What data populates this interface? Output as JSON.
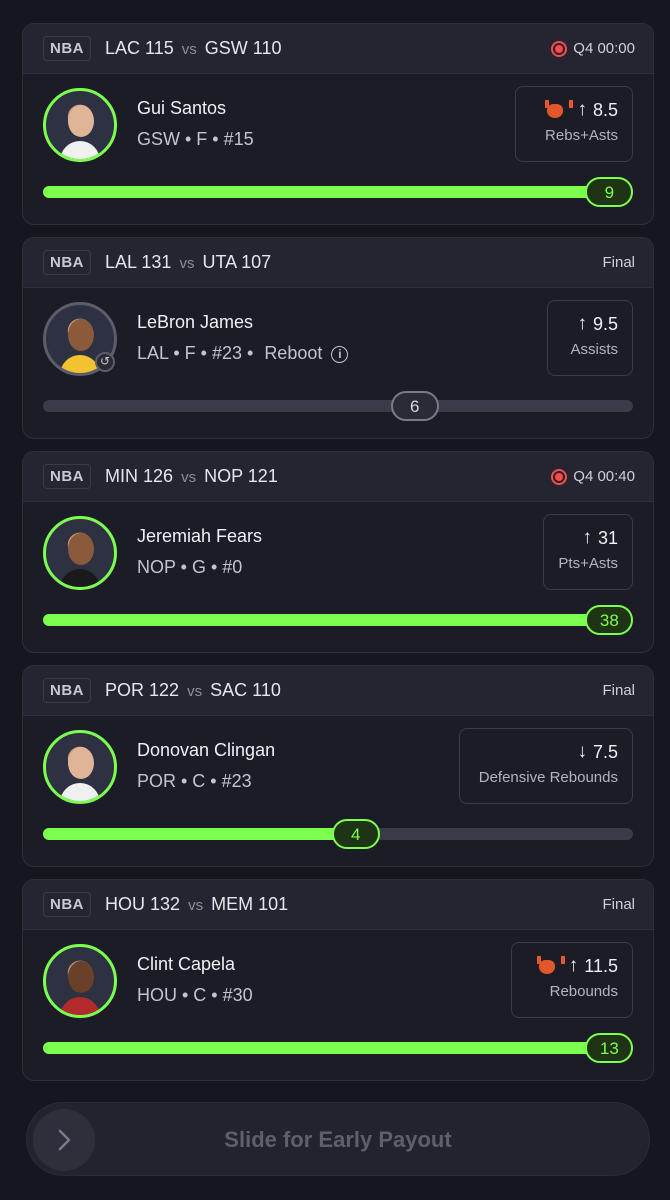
{
  "cards": [
    {
      "league": "NBA",
      "away_team": "LAC",
      "away_score": "115",
      "vs": "vs",
      "home_team": "GSW",
      "home_score": "110",
      "status": "Q4 00:00",
      "live": true,
      "player": "Gui Santos",
      "meta": "GSW • F • #15",
      "direction": "↑",
      "line": "8.5",
      "stat": "Rebs+Asts",
      "demon_icon": true,
      "result": "9",
      "progress": 0.96,
      "hit": true
    },
    {
      "league": "NBA",
      "away_team": "LAL",
      "away_score": "131",
      "vs": "vs",
      "home_team": "UTA",
      "home_score": "107",
      "status": "Final",
      "live": false,
      "player": "LeBron James",
      "meta": "LAL • F • #23 •",
      "meta_extra": "Reboot",
      "direction": "↑",
      "line": "9.5",
      "stat": "Assists",
      "demon_icon": false,
      "result": "6",
      "progress": 0.63,
      "hit": false
    },
    {
      "league": "NBA",
      "away_team": "MIN",
      "away_score": "126",
      "vs": "vs",
      "home_team": "NOP",
      "home_score": "121",
      "status": "Q4 00:40",
      "live": true,
      "player": "Jeremiah Fears",
      "meta": "NOP • G • #0",
      "direction": "↑",
      "line": "31",
      "stat": "Pts+Asts",
      "demon_icon": false,
      "result": "38",
      "progress": 0.96,
      "hit": true
    },
    {
      "league": "NBA",
      "away_team": "POR",
      "away_score": "122",
      "vs": "vs",
      "home_team": "SAC",
      "home_score": "110",
      "status": "Final",
      "live": false,
      "player": "Donovan Clingan",
      "meta": "POR • C • #23",
      "direction": "↓",
      "line": "7.5",
      "stat": "Defensive Rebounds",
      "demon_icon": false,
      "result": "4",
      "progress": 0.53,
      "hit": true
    },
    {
      "league": "NBA",
      "away_team": "HOU",
      "away_score": "132",
      "vs": "vs",
      "home_team": "MEM",
      "home_score": "101",
      "status": "Final",
      "live": false,
      "player": "Clint Capela",
      "meta": "HOU • C • #30",
      "direction": "↑",
      "line": "11.5",
      "stat": "Rebounds",
      "demon_icon": true,
      "result": "13",
      "progress": 0.96,
      "hit": true
    }
  ],
  "slider": {
    "label": "Slide for Early Payout",
    "icon": "chevron-right-icon"
  },
  "colors": {
    "accent": "#7cff4f",
    "live": "#ff4a4a",
    "background": "#15161e",
    "card": "#1b1c26"
  }
}
